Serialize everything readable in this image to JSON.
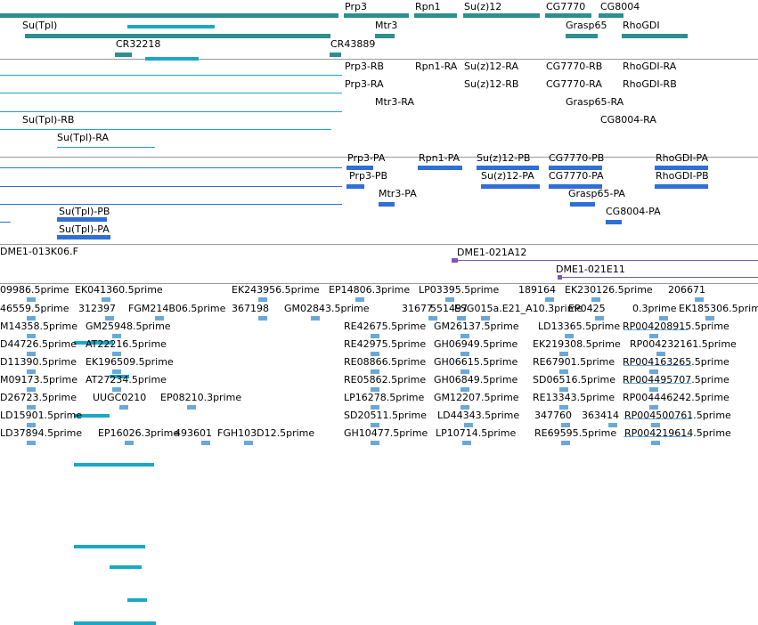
{
  "colors": {
    "gene": "#2d8f8f",
    "transcript": "#1aa8c7",
    "cds": "#2f6fd6",
    "clone": "#7c58b8",
    "est": "#6aa8d8"
  },
  "genes": [
    "Prp3",
    "Rpn1",
    "Su(z)12",
    "CG7770",
    "CG8004",
    "Su(Tpl)",
    "Mtr3",
    "Grasp65",
    "RhoGDI",
    "CR32218",
    "CR43889"
  ],
  "transcripts": [
    "Prp3-RB",
    "Rpn1-RA",
    "Su(z)12-RA",
    "CG7770-RB",
    "RhoGDI-RA",
    "Prp3-RA",
    "Su(z)12-RB",
    "CG7770-RA",
    "RhoGDI-RB",
    "Mtr3-RA",
    "Grasp65-RA",
    "Su(Tpl)-RB",
    "CG8004-RA",
    "Su(Tpl)-RA"
  ],
  "proteins": [
    "Prp3-PA",
    "Rpn1-PA",
    "Su(z)12-PB",
    "CG7770-PB",
    "RhoGDI-PA",
    "Prp3-PB",
    "Su(z)12-PA",
    "CG7770-PA",
    "RhoGDI-PB",
    "Mtr3-PA",
    "Grasp65-PA",
    "Su(Tpl)-PB",
    "CG8004-PA",
    "Su(Tpl)-PA"
  ],
  "clones": [
    "DME1-013K06.F",
    "DME1-021A12",
    "DME1-021E11"
  ],
  "ests": [
    "09986.5prime",
    "EK041360.5prime",
    "EK243956.5prime",
    "EP14806.3prime",
    "LP03395.5prime",
    "189164",
    "EK230126.5prime",
    "206671",
    "46559.5prime",
    "312397",
    "FGM214B06.5prime",
    "367198",
    "GM02843.5prime",
    "31677",
    "551497",
    "ESG015a.E21_A10.3prime",
    "EP0425",
    "0.3prime",
    "EK185306.5prime",
    "M14358.5prime",
    "GM25948.5prime",
    "RE42675.5prime",
    "GM26137.5prime",
    "LD13365.5prime",
    "RP004208915.5prime",
    "D44726.5prime",
    "AT22216.5prime",
    "RE42975.5prime",
    "GH06949.5prime",
    "EK219308.5prime",
    "RP004232161.5prime",
    "D11390.5prime",
    "EK196509.5prime",
    "RE08866.5prime",
    "GH06615.5prime",
    "RE67901.5prime",
    "RP004163265.5prime",
    "M09173.5prime",
    "AT27234.5prime",
    "RE05862.5prime",
    "GH06849.5prime",
    "SD06516.5prime",
    "RP004495707.5prime",
    "D26723.5prime",
    "UUGC0210",
    "EP08210.3prime",
    "LP16278.5prime",
    "GM12207.5prime",
    "RE13343.5prime",
    "RP004446242.5prime",
    "LD15901.5prime",
    "SD20511.5prime",
    "LD44343.5prime",
    "347760",
    "363414",
    "RP004500761.5prime",
    "LD37894.5prime",
    "EP16026.3prime",
    "493601",
    "FGH103D12.5prime",
    "GH10477.5prime",
    "LP10714.5prime",
    "RE69595.5prime",
    "RP004219614.5prime"
  ]
}
